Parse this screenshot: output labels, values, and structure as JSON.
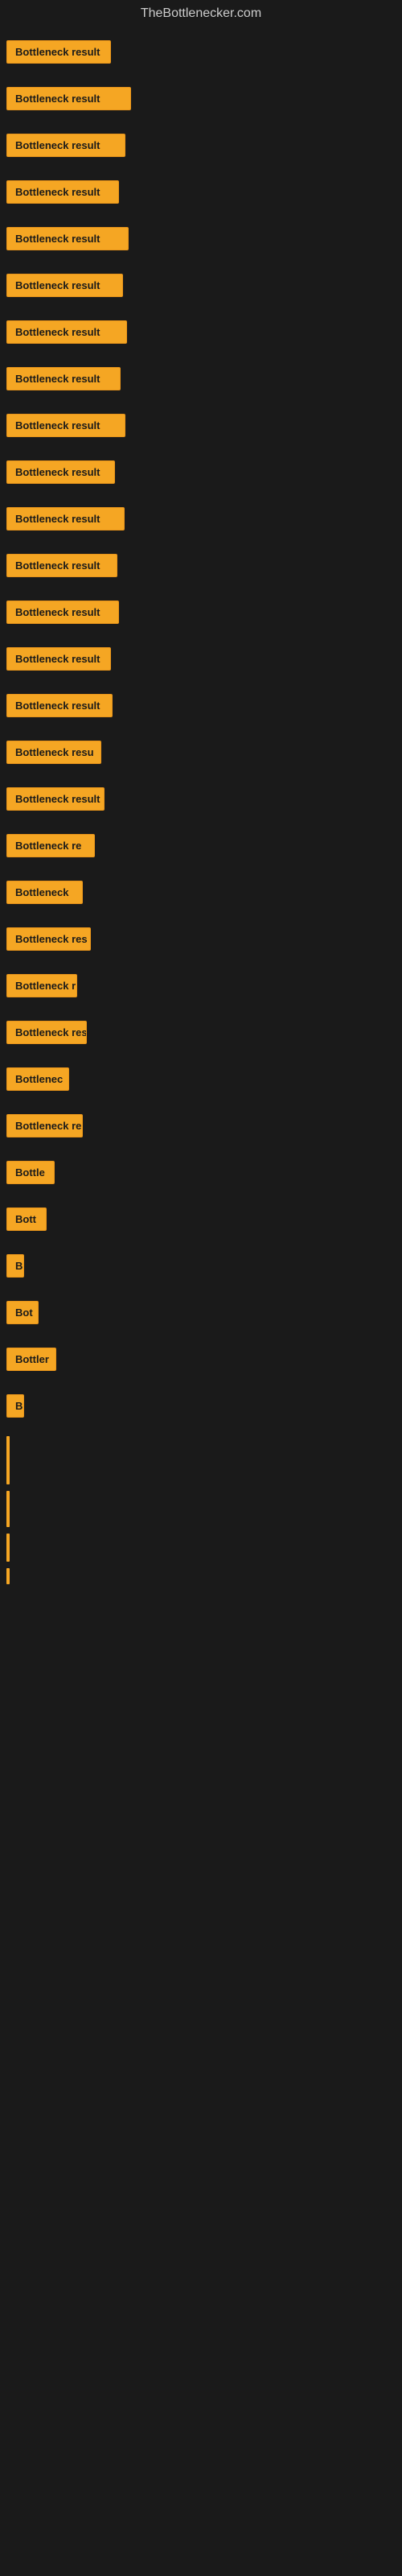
{
  "site": {
    "title": "TheBottlenecker.com"
  },
  "items": [
    {
      "id": 1,
      "label": "Bottleneck result",
      "width_class": "item-w-1"
    },
    {
      "id": 2,
      "label": "Bottleneck result",
      "width_class": "item-w-2"
    },
    {
      "id": 3,
      "label": "Bottleneck result",
      "width_class": "item-w-3"
    },
    {
      "id": 4,
      "label": "Bottleneck result",
      "width_class": "item-w-4"
    },
    {
      "id": 5,
      "label": "Bottleneck result",
      "width_class": "item-w-5"
    },
    {
      "id": 6,
      "label": "Bottleneck result",
      "width_class": "item-w-6"
    },
    {
      "id": 7,
      "label": "Bottleneck result",
      "width_class": "item-w-7"
    },
    {
      "id": 8,
      "label": "Bottleneck result",
      "width_class": "item-w-8"
    },
    {
      "id": 9,
      "label": "Bottleneck result",
      "width_class": "item-w-9"
    },
    {
      "id": 10,
      "label": "Bottleneck result",
      "width_class": "item-w-10"
    },
    {
      "id": 11,
      "label": "Bottleneck result",
      "width_class": "item-w-11"
    },
    {
      "id": 12,
      "label": "Bottleneck result",
      "width_class": "item-w-12"
    },
    {
      "id": 13,
      "label": "Bottleneck result",
      "width_class": "item-w-13"
    },
    {
      "id": 14,
      "label": "Bottleneck result",
      "width_class": "item-w-14"
    },
    {
      "id": 15,
      "label": "Bottleneck result",
      "width_class": "item-w-15"
    },
    {
      "id": 16,
      "label": "Bottleneck resu",
      "width_class": "item-w-16"
    },
    {
      "id": 17,
      "label": "Bottleneck result",
      "width_class": "item-w-17"
    },
    {
      "id": 18,
      "label": "Bottleneck re",
      "width_class": "item-w-18"
    },
    {
      "id": 19,
      "label": "Bottleneck",
      "width_class": "item-w-19"
    },
    {
      "id": 20,
      "label": "Bottleneck res",
      "width_class": "item-w-20"
    },
    {
      "id": 21,
      "label": "Bottleneck r",
      "width_class": "item-w-21"
    },
    {
      "id": 22,
      "label": "Bottleneck resu",
      "width_class": "item-w-22"
    },
    {
      "id": 23,
      "label": "Bottlenec",
      "width_class": "item-w-23"
    },
    {
      "id": 24,
      "label": "Bottleneck re",
      "width_class": "item-w-24"
    },
    {
      "id": 25,
      "label": "Bottle",
      "width_class": "item-w-25"
    },
    {
      "id": 26,
      "label": "Bott",
      "width_class": "item-w-26"
    },
    {
      "id": 27,
      "label": "B",
      "width_class": "item-w-27"
    },
    {
      "id": 28,
      "label": "Bot",
      "width_class": "item-w-28"
    },
    {
      "id": 29,
      "label": "Bottler",
      "width_class": "item-w-29"
    },
    {
      "id": 30,
      "label": "B",
      "width_class": "item-w-30"
    }
  ],
  "bars": [
    {
      "id": 1,
      "height_class": "bar-tall"
    },
    {
      "id": 2,
      "height_class": "bar-medium"
    },
    {
      "id": 3,
      "height_class": "bar-short"
    },
    {
      "id": 4,
      "height_class": "bar-tiny"
    }
  ]
}
